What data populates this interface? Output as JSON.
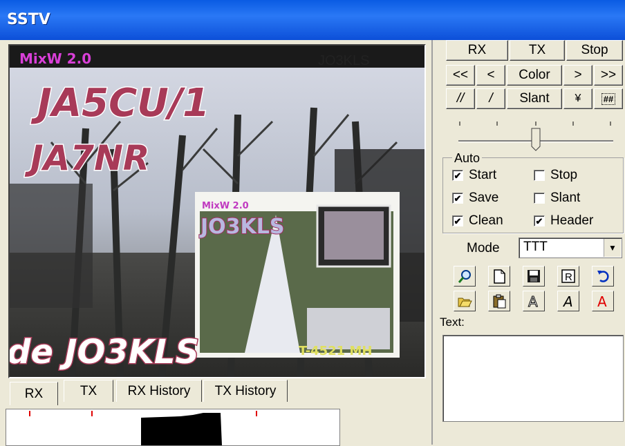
{
  "window": {
    "title": "SSTV"
  },
  "image": {
    "watermark": "MixW 2.0",
    "corner_call": "JO3KLS",
    "call1": "JA5CU/1",
    "call2": "JA7NR",
    "bottom_text": "de JO3KLS",
    "inset_call": "JO3KLS",
    "inset_watermark": "MixW 2.0",
    "inset_bottom": "T-4521 MH"
  },
  "buttons": {
    "rx": "RX",
    "tx": "TX",
    "stop": "Stop",
    "prev_prev": "<<",
    "prev": "<",
    "color": "Color",
    "next": ">",
    "next_next": ">>",
    "slash2": "//",
    "slash": "/",
    "slant": "Slant",
    "yen": "¥",
    "grid": "##"
  },
  "auto": {
    "legend": "Auto",
    "start": {
      "label": "Start",
      "checked": true
    },
    "stop": {
      "label": "Stop",
      "checked": false
    },
    "save": {
      "label": "Save",
      "checked": true
    },
    "slant": {
      "label": "Slant",
      "checked": false
    },
    "clean": {
      "label": "Clean",
      "checked": true
    },
    "header": {
      "label": "Header",
      "checked": true
    }
  },
  "mode": {
    "label": "Mode",
    "value": "TTT"
  },
  "text": {
    "label": "Text:",
    "value": ""
  },
  "tabs": [
    "RX",
    "TX",
    "RX History",
    "TX History"
  ],
  "icons": [
    "zoom-icon",
    "new-page-icon",
    "save-disk-icon",
    "r-box-icon",
    "undo-icon",
    "open-folder-icon",
    "paste-icon",
    "text-outline-a-icon",
    "text-italic-a-icon",
    "text-red-a-icon"
  ],
  "colors": {
    "titlebar": "#0a5be3",
    "face": "#ece9d8",
    "red_a": "#e00000"
  }
}
